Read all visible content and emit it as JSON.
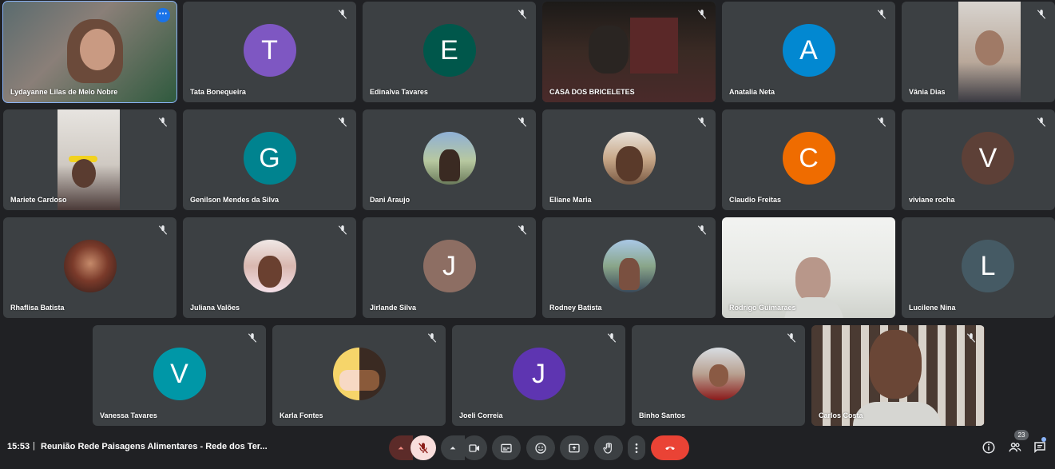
{
  "participants_row1": [
    {
      "name": "Lydayanne Lilas de Melo Nobre",
      "type": "video",
      "active": true
    },
    {
      "name": "Tata Bonequeira",
      "type": "initial",
      "initial": "T",
      "color": "#7e57c2"
    },
    {
      "name": "Edinalva Tavares",
      "type": "initial",
      "initial": "E",
      "color": "#00574b"
    },
    {
      "name": "CASA DOS BRICELETES",
      "type": "video"
    },
    {
      "name": "Anatalia Neta",
      "type": "initial",
      "initial": "A",
      "color": "#0288d1"
    },
    {
      "name": "Vânia Dias",
      "type": "video"
    }
  ],
  "participants_row2": [
    {
      "name": "Mariete Cardoso",
      "type": "video"
    },
    {
      "name": "Genilson Mendes da Silva",
      "type": "initial",
      "initial": "G",
      "color": "#00838f"
    },
    {
      "name": "Dani Araujo",
      "type": "photo"
    },
    {
      "name": "Eliane Maria",
      "type": "photo"
    },
    {
      "name": "Claudio Freitas",
      "type": "initial",
      "initial": "C",
      "color": "#ef6c00"
    },
    {
      "name": "viviane rocha",
      "type": "initial",
      "initial": "V",
      "color": "#5d4037"
    }
  ],
  "participants_row3": [
    {
      "name": "Rhaflisa Batista",
      "type": "photo"
    },
    {
      "name": "Juliana Valões",
      "type": "photo"
    },
    {
      "name": "Jirlande Silva",
      "type": "initial",
      "initial": "J",
      "color": "#8d6e63"
    },
    {
      "name": "Rodney Batista",
      "type": "photo"
    },
    {
      "name": "Rodrigo Guimaraes",
      "type": "video"
    },
    {
      "name": "Lucilene Nina",
      "type": "initial",
      "initial": "L",
      "color": "#455a64"
    }
  ],
  "participants_row4": [
    {
      "name": "Vanessa Tavares",
      "type": "initial",
      "initial": "V",
      "color": "#0097a7"
    },
    {
      "name": "Karla Fontes",
      "type": "photo"
    },
    {
      "name": "Joeli Correia",
      "type": "initial",
      "initial": "J",
      "color": "#5e35b1"
    },
    {
      "name": "Binho Santos",
      "type": "photo"
    },
    {
      "name": "Carlos Costa",
      "type": "video"
    }
  ],
  "bottombar": {
    "time": "15:53",
    "separator": "|",
    "meeting_title": "Reunião Rede Paisagens Alimentares - Rede dos Ter...",
    "participant_count": "23"
  },
  "icons": {
    "more_options": "⋯"
  },
  "colors": {
    "background": "#202124",
    "tile": "#3c4043",
    "end_call": "#ea4335",
    "mic_off": "#f28b82"
  }
}
